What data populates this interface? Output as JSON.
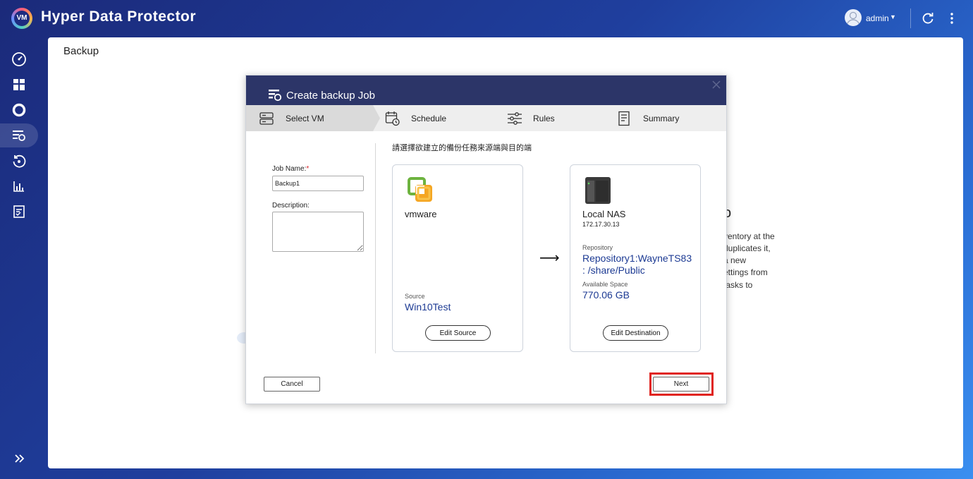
{
  "app": {
    "logo_text": "VM",
    "title": "Hyper Data Protector"
  },
  "user": {
    "name": "admin"
  },
  "page": {
    "title": "Backup"
  },
  "background_panel": {
    "heading_fragment": "o",
    "lines": [
      "ventory at the",
      "duplicates it,",
      "a new",
      "ettings from",
      "tasks to"
    ]
  },
  "modal": {
    "title": "Create backup Job",
    "steps": [
      {
        "label": "Select VM",
        "icon": "server-icon"
      },
      {
        "label": "Schedule",
        "icon": "calendar-clock-icon"
      },
      {
        "label": "Rules",
        "icon": "sliders-icon"
      },
      {
        "label": "Summary",
        "icon": "document-icon"
      }
    ],
    "form": {
      "job_name_label": "Job Name:",
      "required_mark": "*",
      "job_name_value": "Backup1",
      "description_label": "Description:"
    },
    "instruction": "請選擇欲建立的備份任務來源端與目的端",
    "source": {
      "vendor": "vmware",
      "label": "Source",
      "value": "Win10Test",
      "edit_label": "Edit Source"
    },
    "destination": {
      "name": "Local NAS",
      "ip": "172.17.30.13",
      "repo_label": "Repository",
      "repo_value_line1": "Repository1:WayneTS83",
      "repo_value_line2": ": /share/Public",
      "space_label": "Available Space",
      "space_value": "770.06 GB",
      "edit_label": "Edit Destination"
    },
    "arrow": "⟶",
    "cancel_label": "Cancel",
    "next_label": "Next"
  },
  "colors": {
    "header_bg": "#2c3568",
    "accent_blue": "#1c3a93",
    "highlight_red": "#e0241f"
  }
}
